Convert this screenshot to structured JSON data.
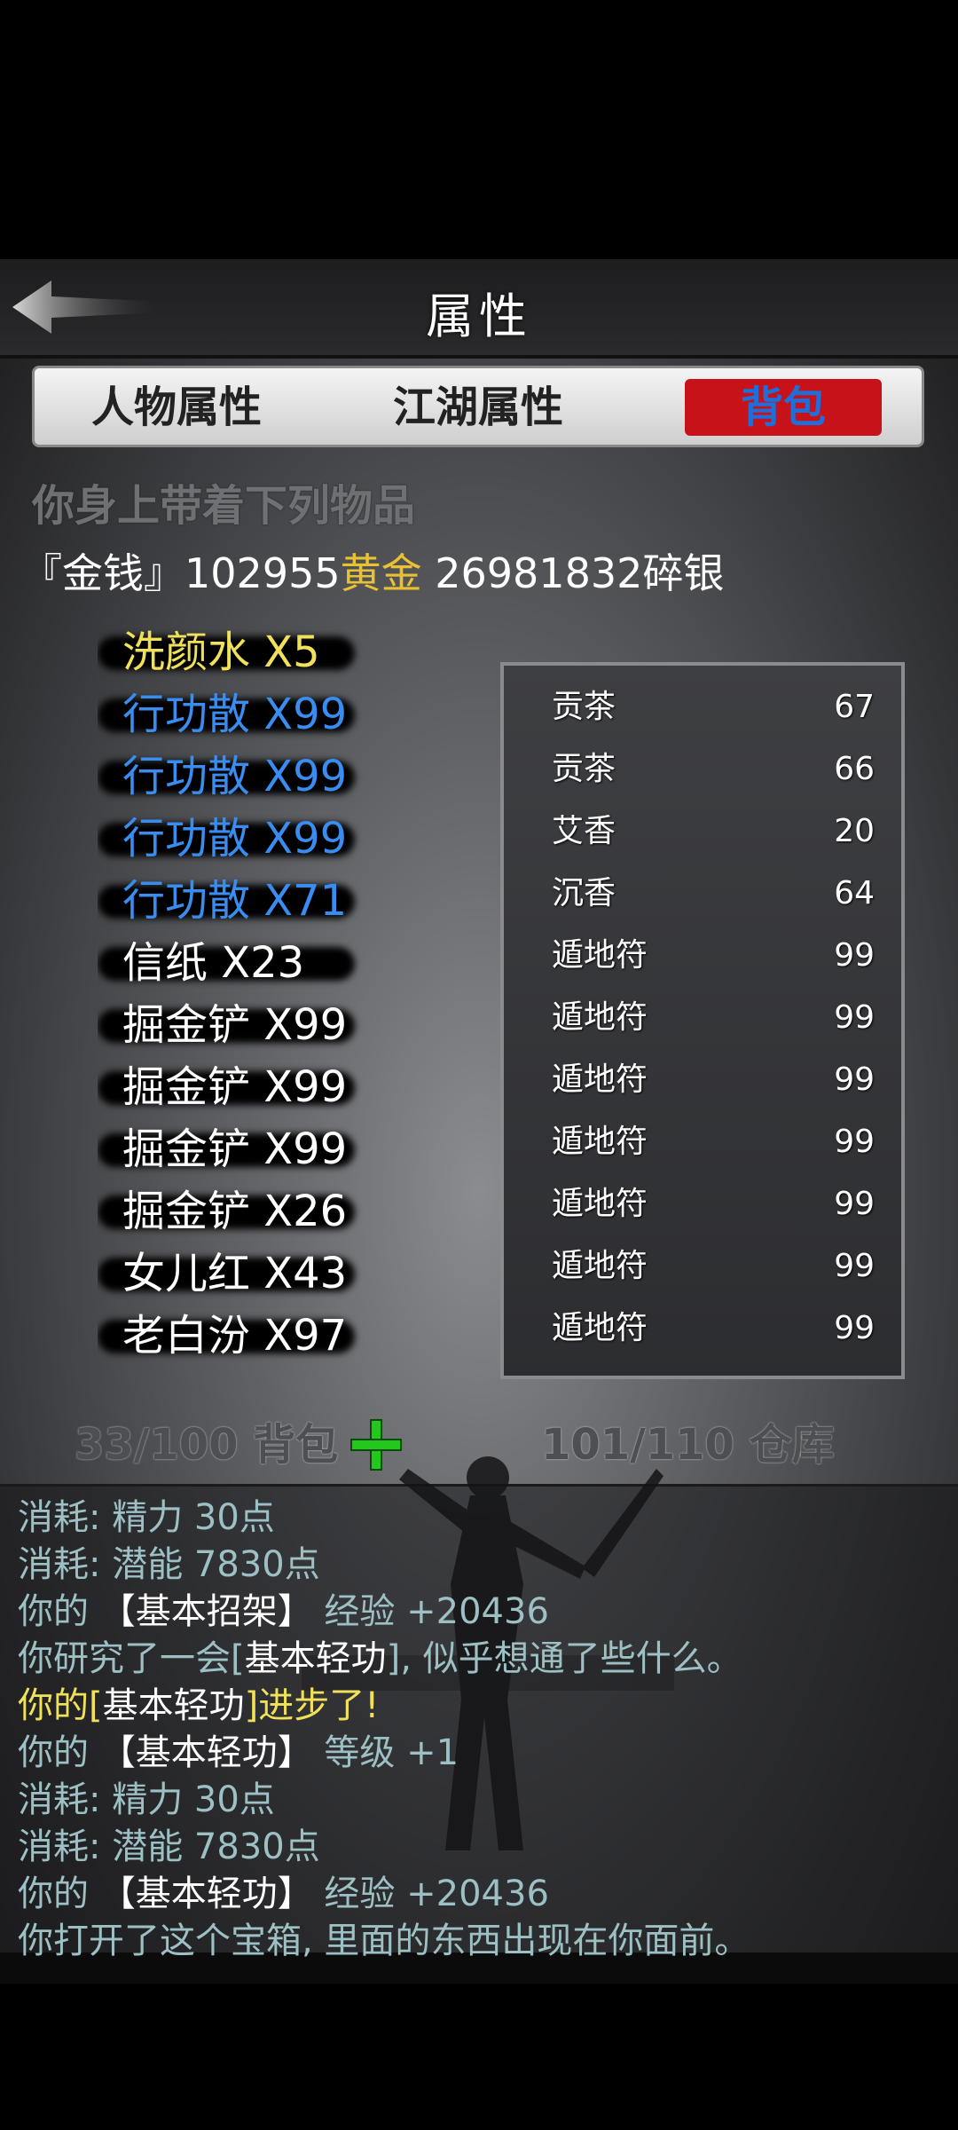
{
  "header": {
    "title": "属性"
  },
  "tabs": [
    {
      "label": "人物属性",
      "active": false
    },
    {
      "label": "江湖属性",
      "active": false
    },
    {
      "label": "背包",
      "active": true
    }
  ],
  "subtitle": "你身上带着下列物品",
  "money": {
    "label": "『金钱』",
    "gold_amount": "102955",
    "gold_unit": "黄金",
    "silver_amount": "26981832",
    "silver_unit": "碎银"
  },
  "items": [
    {
      "text": "洗颜水 X5",
      "color": "#f1e15a"
    },
    {
      "text": "行功散 X99",
      "color": "#3a8df0"
    },
    {
      "text": "行功散 X99",
      "color": "#3a8df0"
    },
    {
      "text": "行功散 X99",
      "color": "#3a8df0"
    },
    {
      "text": "行功散 X71",
      "color": "#3a8df0"
    },
    {
      "text": "信纸 X23",
      "color": "#ffffff"
    },
    {
      "text": "掘金铲 X99",
      "color": "#ffffff"
    },
    {
      "text": "掘金铲 X99",
      "color": "#ffffff"
    },
    {
      "text": "掘金铲 X99",
      "color": "#ffffff"
    },
    {
      "text": "掘金铲 X26",
      "color": "#ffffff"
    },
    {
      "text": "女儿红 X43",
      "color": "#ffffff"
    },
    {
      "text": "老白汾 X97",
      "color": "#ffffff"
    }
  ],
  "storage": [
    {
      "name": "贡茶",
      "count": "67"
    },
    {
      "name": "贡茶",
      "count": "66"
    },
    {
      "name": "艾香",
      "count": "20"
    },
    {
      "name": "沉香",
      "count": "64"
    },
    {
      "name": "遁地符",
      "count": "99"
    },
    {
      "name": "遁地符",
      "count": "99"
    },
    {
      "name": "遁地符",
      "count": "99"
    },
    {
      "name": "遁地符",
      "count": "99"
    },
    {
      "name": "遁地符",
      "count": "99"
    },
    {
      "name": "遁地符",
      "count": "99"
    },
    {
      "name": "遁地符",
      "count": "99"
    }
  ],
  "footer": {
    "bag_label": "33/100 背包",
    "warehouse_label": "101/110 仓库"
  },
  "log": [
    {
      "a": "消耗:",
      "b": " 精力 30点",
      "c": ""
    },
    {
      "a": "消耗:",
      "b": " 潜能 7830点",
      "c": ""
    },
    {
      "a": "你的 ",
      "w": "【基本招架】",
      "b": " 经验 +20436"
    },
    {
      "a": "你研究了一会[",
      "w": "基本轻功",
      "b": "], 似乎想通了些什么。"
    },
    {
      "y1": "你的[",
      "w": "基本轻功",
      "y2": "]进步了!"
    },
    {
      "a": "你的 ",
      "w": "【基本轻功】",
      "b": " 等级 +1"
    },
    {
      "a": "消耗:",
      "b": " 精力 30点",
      "c": ""
    },
    {
      "a": "消耗:",
      "b": " 潜能 7830点",
      "c": ""
    },
    {
      "a": "你的 ",
      "w": "【基本轻功】",
      "b": " 经验 +20436"
    },
    {
      "a": "你打开了这个宝箱, 里面的东西出现在你面前。",
      "b": ""
    }
  ],
  "colors": {
    "gold": "#e8c233",
    "tab_active_bg": "#c8121a",
    "tab_active_text": "#1e6fd9",
    "plus_green": "#22c81c",
    "log_text": "#9dc0c4"
  }
}
